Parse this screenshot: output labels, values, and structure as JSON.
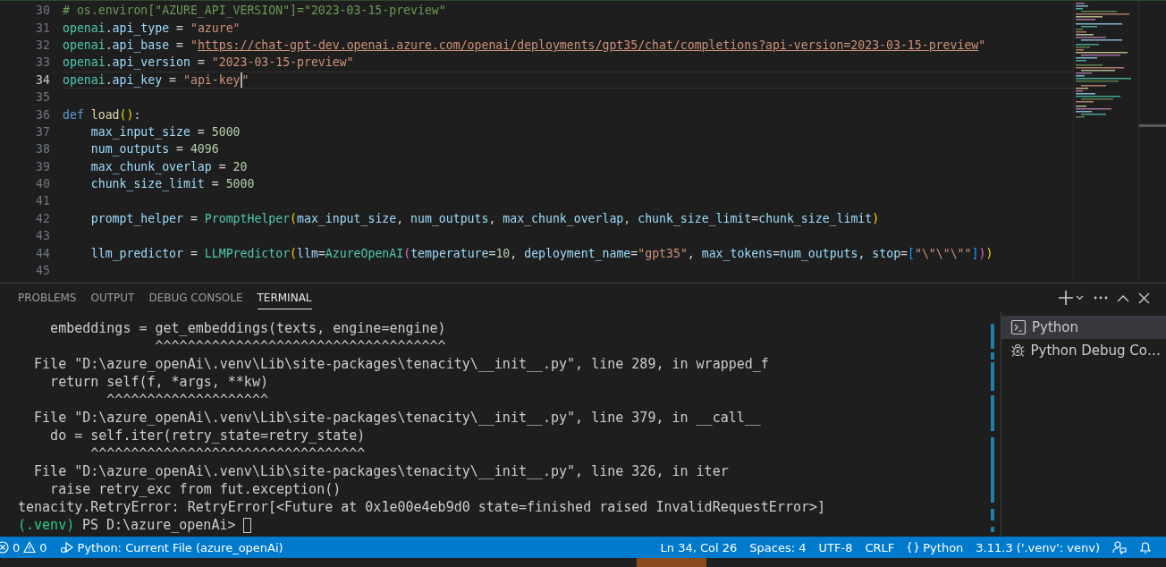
{
  "editor": {
    "lines": [
      {
        "number": "30",
        "current": false,
        "tokens": [
          {
            "text": "# os.environ[\"AZURE_API_VERSION\"]=\"2023-03-15-preview\"",
            "kind": "comment"
          }
        ]
      },
      {
        "number": "31",
        "current": false,
        "tokens": [
          {
            "text": "openai",
            "kind": "module"
          },
          {
            "text": ".",
            "kind": "op"
          },
          {
            "text": "api_type",
            "kind": "var"
          },
          {
            "text": " = ",
            "kind": "op"
          },
          {
            "text": "\"azure\"",
            "kind": "str"
          }
        ]
      },
      {
        "number": "32",
        "current": false,
        "tokens": [
          {
            "text": "openai",
            "kind": "module"
          },
          {
            "text": ".",
            "kind": "op"
          },
          {
            "text": "api_base",
            "kind": "var"
          },
          {
            "text": " = ",
            "kind": "op"
          },
          {
            "text": "\"",
            "kind": "str"
          },
          {
            "text": "https://chat-gpt-dev.openai.azure.com/openai/deployments/gpt35/chat/completions?api-version=2023-03-15-preview",
            "kind": "url"
          },
          {
            "text": "\"",
            "kind": "str"
          }
        ]
      },
      {
        "number": "33",
        "current": false,
        "tokens": [
          {
            "text": "openai",
            "kind": "module"
          },
          {
            "text": ".",
            "kind": "op"
          },
          {
            "text": "api_version",
            "kind": "var"
          },
          {
            "text": " = ",
            "kind": "op"
          },
          {
            "text": "\"2023-03-15-preview\"",
            "kind": "str"
          }
        ]
      },
      {
        "number": "34",
        "current": true,
        "tokens": [
          {
            "text": "openai",
            "kind": "module"
          },
          {
            "text": ".",
            "kind": "op"
          },
          {
            "text": "api_key",
            "kind": "var"
          },
          {
            "text": " = ",
            "kind": "op"
          },
          {
            "text": "\"api-key",
            "kind": "str"
          },
          {
            "kind": "cursor"
          },
          {
            "text": "\"",
            "kind": "str"
          }
        ]
      },
      {
        "number": "35",
        "current": false
      },
      {
        "number": "36",
        "current": false,
        "tokens": [
          {
            "text": "def ",
            "kind": "keyword"
          },
          {
            "text": "load",
            "kind": "func"
          },
          {
            "text": "()",
            "kind": "bracket1"
          },
          {
            "text": ":",
            "kind": "op"
          }
        ]
      },
      {
        "number": "37",
        "current": false,
        "tokens": [
          {
            "text": "    max_input_size",
            "kind": "var"
          },
          {
            "text": " = ",
            "kind": "op"
          },
          {
            "text": "5000",
            "kind": "num"
          }
        ]
      },
      {
        "number": "38",
        "current": false,
        "tokens": [
          {
            "text": "    num_outputs",
            "kind": "var"
          },
          {
            "text": " = ",
            "kind": "op"
          },
          {
            "text": "4096",
            "kind": "num"
          }
        ]
      },
      {
        "number": "39",
        "current": false,
        "tokens": [
          {
            "text": "    max_chunk_overlap",
            "kind": "var"
          },
          {
            "text": " = ",
            "kind": "op"
          },
          {
            "text": "20",
            "kind": "num"
          }
        ]
      },
      {
        "number": "40",
        "current": false,
        "tokens": [
          {
            "text": "    chunk_size_limit",
            "kind": "var"
          },
          {
            "text": " = ",
            "kind": "op"
          },
          {
            "text": "5000",
            "kind": "num"
          }
        ]
      },
      {
        "number": "41",
        "current": false
      },
      {
        "number": "42",
        "current": false,
        "tokens": [
          {
            "text": "    prompt_helper",
            "kind": "var"
          },
          {
            "text": " = ",
            "kind": "op"
          },
          {
            "text": "PromptHelper",
            "kind": "class"
          },
          {
            "text": "(",
            "kind": "bracket1"
          },
          {
            "text": "max_input_size",
            "kind": "var"
          },
          {
            "text": ", ",
            "kind": "op"
          },
          {
            "text": "num_outputs",
            "kind": "var"
          },
          {
            "text": ", ",
            "kind": "op"
          },
          {
            "text": "max_chunk_overlap",
            "kind": "var"
          },
          {
            "text": ", ",
            "kind": "op"
          },
          {
            "text": "chunk_size_limit",
            "kind": "var"
          },
          {
            "text": "=",
            "kind": "op"
          },
          {
            "text": "chunk_size_limit",
            "kind": "var"
          },
          {
            "text": ")",
            "kind": "bracket1"
          }
        ]
      },
      {
        "number": "43",
        "current": false
      },
      {
        "number": "44",
        "current": false,
        "tokens": [
          {
            "text": "    llm_predictor",
            "kind": "var"
          },
          {
            "text": " = ",
            "kind": "op"
          },
          {
            "text": "LLMPredictor",
            "kind": "class"
          },
          {
            "text": "(",
            "kind": "bracket1"
          },
          {
            "text": "llm",
            "kind": "var"
          },
          {
            "text": "=",
            "kind": "op"
          },
          {
            "text": "AzureOpenAI",
            "kind": "class"
          },
          {
            "text": "(",
            "kind": "bracket2"
          },
          {
            "text": "temperature",
            "kind": "var"
          },
          {
            "text": "=",
            "kind": "op"
          },
          {
            "text": "10",
            "kind": "num"
          },
          {
            "text": ", ",
            "kind": "op"
          },
          {
            "text": "deployment_name",
            "kind": "var"
          },
          {
            "text": "=",
            "kind": "op"
          },
          {
            "text": "\"gpt35\"",
            "kind": "str"
          },
          {
            "text": ", ",
            "kind": "op"
          },
          {
            "text": "max_tokens",
            "kind": "var"
          },
          {
            "text": "=",
            "kind": "op"
          },
          {
            "text": "num_outputs",
            "kind": "var"
          },
          {
            "text": ", ",
            "kind": "op"
          },
          {
            "text": "stop",
            "kind": "var"
          },
          {
            "text": "=",
            "kind": "op"
          },
          {
            "text": "[",
            "kind": "bracket3"
          },
          {
            "text": "\"\\\"\\\"\\\"\"",
            "kind": "str"
          },
          {
            "text": "]",
            "kind": "bracket3"
          },
          {
            "text": ")",
            "kind": "bracket2"
          },
          {
            "text": ")",
            "kind": "bracket1"
          }
        ]
      },
      {
        "number": "45",
        "current": false
      }
    ]
  },
  "panel": {
    "tabs": [
      {
        "label": "PROBLEMS",
        "selected": false
      },
      {
        "label": "OUTPUT",
        "selected": false
      },
      {
        "label": "DEBUG CONSOLE",
        "selected": false
      },
      {
        "label": "TERMINAL",
        "selected": true
      }
    ],
    "terminal_lines": [
      "    embeddings = get_embeddings(texts, engine=engine)",
      "                 ^^^^^^^^^^^^^^^^^^^^^^^^^^^^^^^^^^^^",
      "  File \"D:\\azure_openAi\\.venv\\Lib\\site-packages\\tenacity\\__init__.py\", line 289, in wrapped_f",
      "    return self(f, *args, **kw)",
      "           ^^^^^^^^^^^^^^^^^^^^",
      "  File \"D:\\azure_openAi\\.venv\\Lib\\site-packages\\tenacity\\__init__.py\", line 379, in __call__",
      "    do = self.iter(retry_state=retry_state)",
      "         ^^^^^^^^^^^^^^^^^^^^^^^^^^^^^^^^^^",
      "  File \"D:\\azure_openAi\\.venv\\Lib\\site-packages\\tenacity\\__init__.py\", line 326, in iter",
      "    raise retry_exc from fut.exception()",
      "tenacity.RetryError: RetryError[<Future at 0x1e00e4eb9d0 state=finished raised InvalidRequestError>]"
    ],
    "prompt": {
      "env": "(.venv)",
      "text": "PS D:\\azure_openAi>"
    },
    "terminals": [
      {
        "label": "Python",
        "kind": "shell",
        "selected": true
      },
      {
        "label": "Python Debug Co…",
        "kind": "debug",
        "selected": false
      }
    ]
  },
  "status_bar": {
    "errors": "0",
    "warnings": "0",
    "launch": "Python: Current File (azure_openAi)",
    "position": "Ln 34, Col 26",
    "indent": "Spaces: 4",
    "encoding": "UTF-8",
    "eol": "CRLF",
    "language": "Python",
    "interpreter": "3.11.3 ('.venv': venv)"
  }
}
